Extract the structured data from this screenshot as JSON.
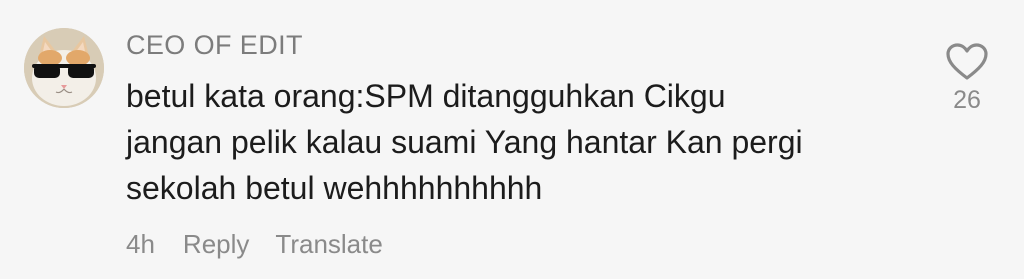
{
  "comment": {
    "username": "CEO OF EDIT",
    "text": "betul kata orang:SPM ditangguhkan Cikgu\njangan pelik kalau suami Yang hantar Kan pergi\nsekolah betul wehhhhhhhhhh",
    "time": "4h",
    "reply_label": "Reply",
    "translate_label": "Translate",
    "like_count": "26",
    "avatar_icon": "cat-with-sunglasses-avatar",
    "like_icon": "heart-outline-icon"
  }
}
